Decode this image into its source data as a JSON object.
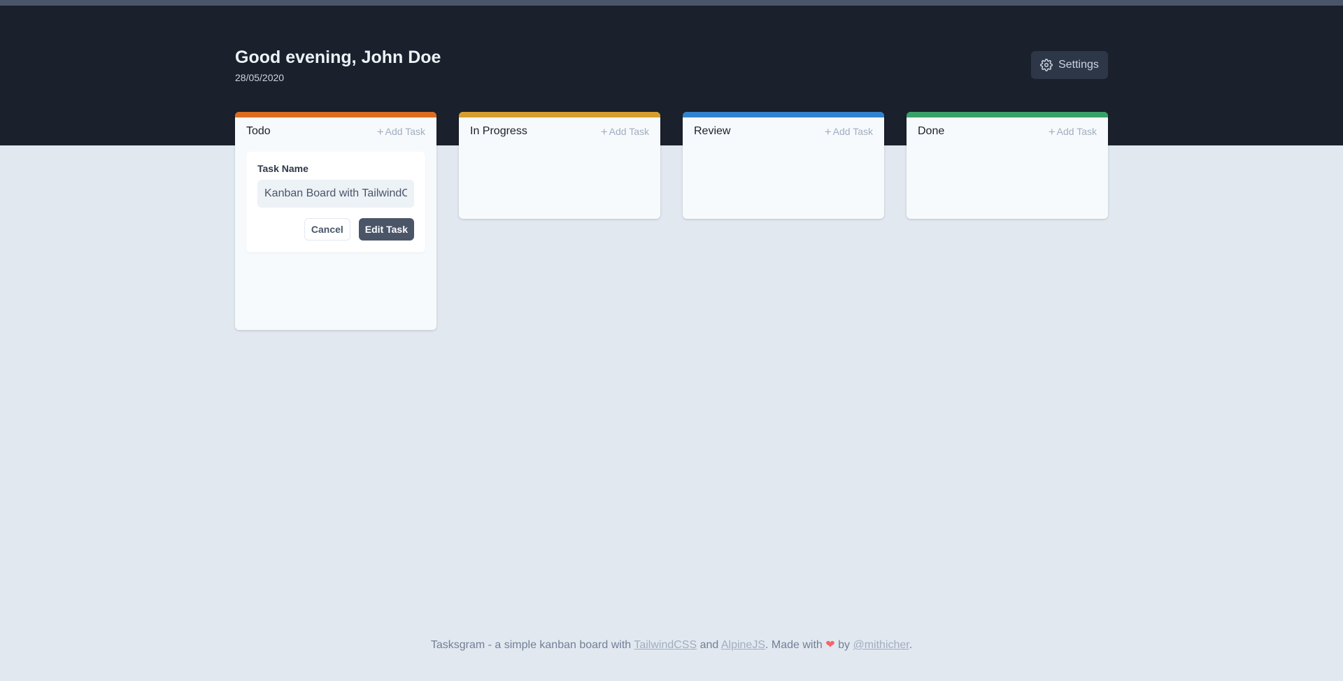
{
  "header": {
    "greeting": "Good evening, John Doe",
    "date": "28/05/2020",
    "settings_label": "Settings"
  },
  "columns": [
    {
      "title": "Todo",
      "add_label": "Add Task",
      "color": "#dd6b20"
    },
    {
      "title": "In Progress",
      "add_label": "Add Task",
      "color": "#d69e2e"
    },
    {
      "title": "Review",
      "add_label": "Add Task",
      "color": "#3182ce"
    },
    {
      "title": "Done",
      "add_label": "Add Task",
      "color": "#38a169"
    }
  ],
  "task_form": {
    "label": "Task Name",
    "value": "Kanban Board with TailwindCSS",
    "cancel_label": "Cancel",
    "submit_label": "Edit Task"
  },
  "footer": {
    "text1": "Tasksgram - a simple kanban board with ",
    "link1": "TailwindCSS",
    "text2": " and ",
    "link2": "AlpineJS",
    "text3": ". Made with ",
    "heart": "❤",
    "text4": " by ",
    "link3": "@mithicher",
    "text5": "."
  }
}
